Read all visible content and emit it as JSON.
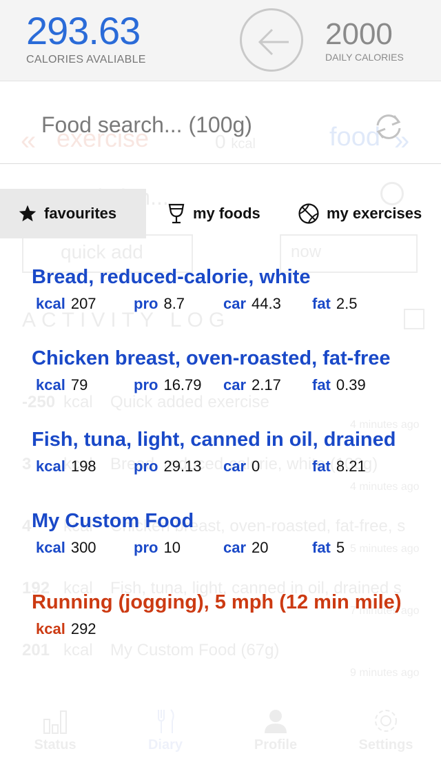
{
  "header": {
    "calories_available": "293.63",
    "calories_available_label": "CALORIES AVALIABLE",
    "daily_calories": "2000",
    "daily_calories_label": "DAILY CALORIES"
  },
  "background": {
    "exercise_label": "exercise",
    "zero_kcal": "0",
    "kcal_unit": "kcal",
    "food_label": "food",
    "description_placeholder": "Description...",
    "quick_add": "quick add",
    "now": "now",
    "activity_log": "ACTIVITY LOG",
    "log": [
      {
        "amount": "-250",
        "unit": "kcal",
        "text": "Quick added exercise",
        "time": "4 minutes ago"
      },
      {
        "amount": "3",
        "unit": "kcal",
        "text": "Bread, reduced-calorie, white (100g)",
        "time": "4 minutes ago"
      },
      {
        "amount": "4",
        "unit": "kcal",
        "text": "Chicken breast, oven-roasted, fat-free, s",
        "time": "5 minutes ago"
      },
      {
        "amount": "192",
        "unit": "kcal",
        "text": "Fish, tuna, light, canned in oil, drained s",
        "time": "7 minutes ago"
      },
      {
        "amount": "201",
        "unit": "kcal",
        "text": "My Custom Food (67g)",
        "time": "9 minutes ago"
      }
    ]
  },
  "search": {
    "placeholder": "Food search... (100g)"
  },
  "tabs": [
    {
      "label": "favourites",
      "icon": "star-icon",
      "active": true
    },
    {
      "label": "my foods",
      "icon": "goblet-icon",
      "active": false
    },
    {
      "label": "my exercises",
      "icon": "ball-icon",
      "active": false
    }
  ],
  "macro_labels": {
    "kcal": "kcal",
    "pro": "pro",
    "car": "car",
    "fat": "fat"
  },
  "foods": [
    {
      "name": "Bread, reduced-calorie, white",
      "kcal": "207",
      "pro": "8.7",
      "car": "44.3",
      "fat": "2.5"
    },
    {
      "name": "Chicken breast, oven-roasted, fat-free",
      "kcal": "79",
      "pro": "16.79",
      "car": "2.17",
      "fat": "0.39"
    },
    {
      "name": "Fish, tuna, light, canned in oil, drained",
      "kcal": "198",
      "pro": "29.13",
      "car": "0",
      "fat": "8.21"
    },
    {
      "name": "My Custom Food",
      "kcal": "300",
      "pro": "10",
      "car": "20",
      "fat": "5"
    }
  ],
  "exercise": {
    "name": "Running (jogging), 5 mph (12 min mile)",
    "kcal": "292"
  },
  "tabbar": [
    {
      "label": "Status",
      "icon": "bar-chart-icon"
    },
    {
      "label": "Diary",
      "icon": "fork-knife-icon"
    },
    {
      "label": "Profile",
      "icon": "person-icon"
    },
    {
      "label": "Settings",
      "icon": "gear-icon"
    }
  ],
  "colors": {
    "accent_blue": "#1a49c8",
    "header_blue": "#2a6bd8",
    "exercise_orange": "#cc3a12"
  }
}
